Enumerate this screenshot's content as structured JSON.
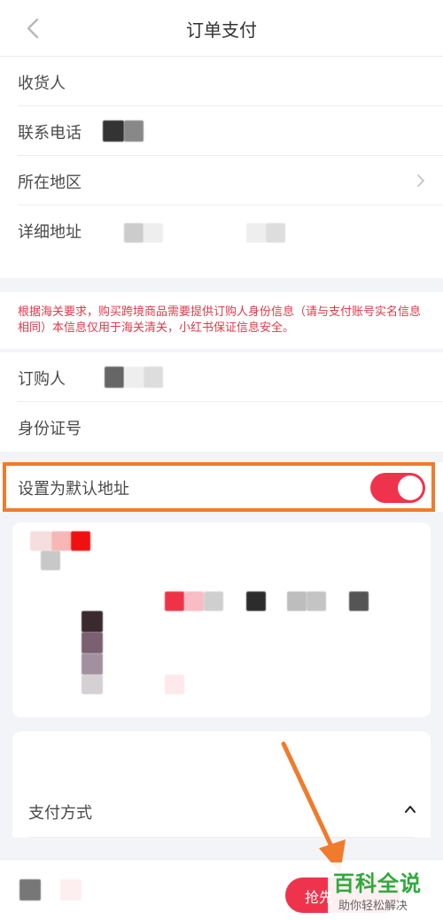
{
  "header": {
    "title": "订单支付"
  },
  "address": {
    "receiver_label": "收货人",
    "phone_label": "联系电话",
    "region_label": "所在地区",
    "detail_label": "详细地址"
  },
  "customs": {
    "notice": "根据海关要求，购买跨境商品需要提供订购人身份信息（请与支付账号实名信息相同）本信息仅用于海关清关，小红书保证信息安全。",
    "buyer_label": "订购人",
    "id_label": "身份证号"
  },
  "default_address": {
    "label": "设置为默认地址",
    "enabled": true
  },
  "payment": {
    "label": "支付方式"
  },
  "bottom": {
    "button_label": "抢先"
  },
  "watermark": {
    "title": "百科全说",
    "subtitle": "助你轻松解决"
  },
  "colors": {
    "accent": "#f0334c",
    "highlight": "#f07b2c",
    "notice": "#e03a4a",
    "watermark": "#2eaa3c"
  }
}
